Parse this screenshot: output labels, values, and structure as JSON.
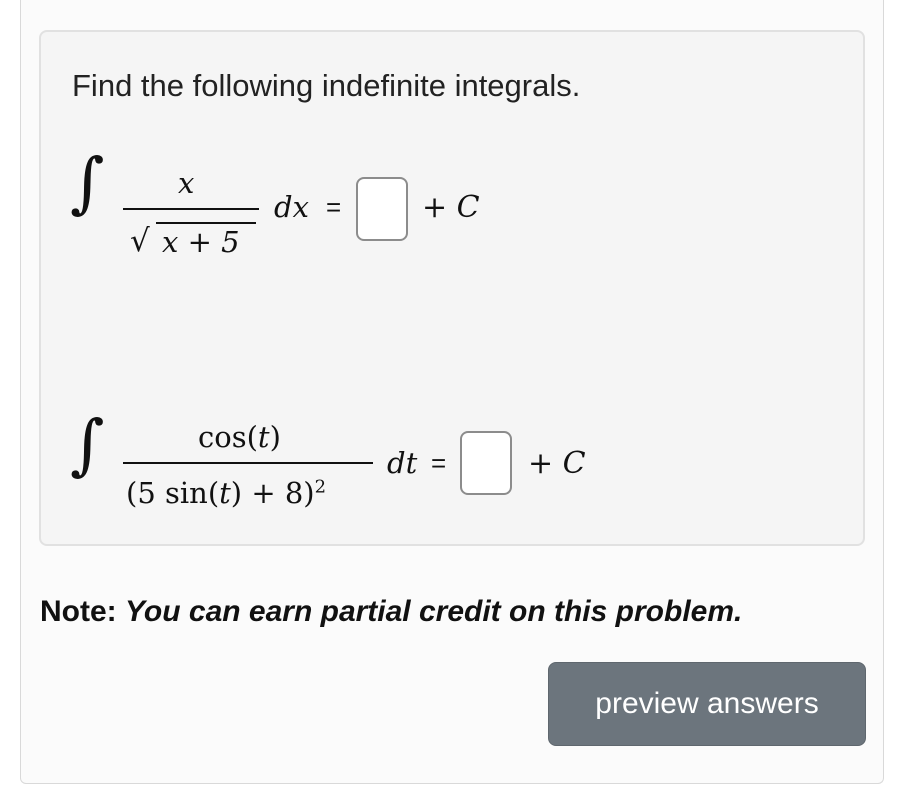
{
  "problem": {
    "instruction": "Find the following indefinite integrals.",
    "integral_1": {
      "integral_sign": "∫",
      "numerator": "x",
      "denominator_radical": "√",
      "denominator_radicand": "x + 5",
      "differential": "dx",
      "equals": "=",
      "answer_value": "",
      "constant": "+ C"
    },
    "integral_2": {
      "integral_sign": "∫",
      "numerator_func": "cos(",
      "numerator_var": "t",
      "numerator_close": ")",
      "denominator_open": "(5 sin(",
      "denominator_var": "t",
      "denominator_rest": ") + 8)",
      "denominator_exponent": "2",
      "differential": "dt",
      "equals": "=",
      "answer_value": "",
      "constant": "+ C"
    }
  },
  "note": {
    "label": "Note:",
    "text": "You can earn partial credit on this problem."
  },
  "actions": {
    "preview_label": "preview answers"
  }
}
